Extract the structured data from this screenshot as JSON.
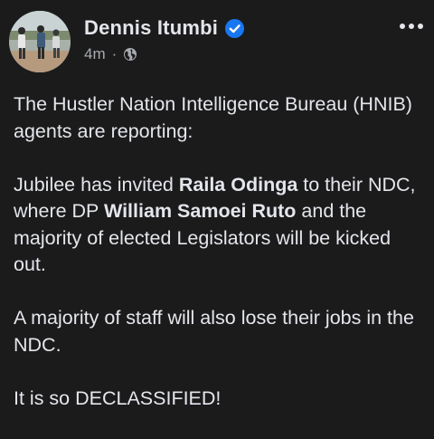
{
  "post": {
    "author": "Dennis Itumbi",
    "verified": true,
    "timestamp": "4m",
    "separator": "·",
    "audience_icon": "globe-icon",
    "more_icon": "more-options-icon",
    "paragraphs": {
      "p1": "The Hustler Nation Intelligence Bureau (HNIB) agents are reporting:",
      "p2_part1": "Jubilee has invited ",
      "p2_bold1": "Raila Odinga",
      "p2_part2": " to their NDC, where DP ",
      "p2_bold2": "William Samoei Ruto",
      "p2_part3": " and the majority of elected Legislators will be kicked out.",
      "p3": "A majority of staff will also lose their jobs in the NDC.",
      "p4": "It is so DECLASSIFIED!"
    }
  },
  "colors": {
    "background": "#1b1b1c",
    "text": "#e4e6eb",
    "secondary_text": "#a8abb0",
    "verified_badge": "#1877f2"
  }
}
